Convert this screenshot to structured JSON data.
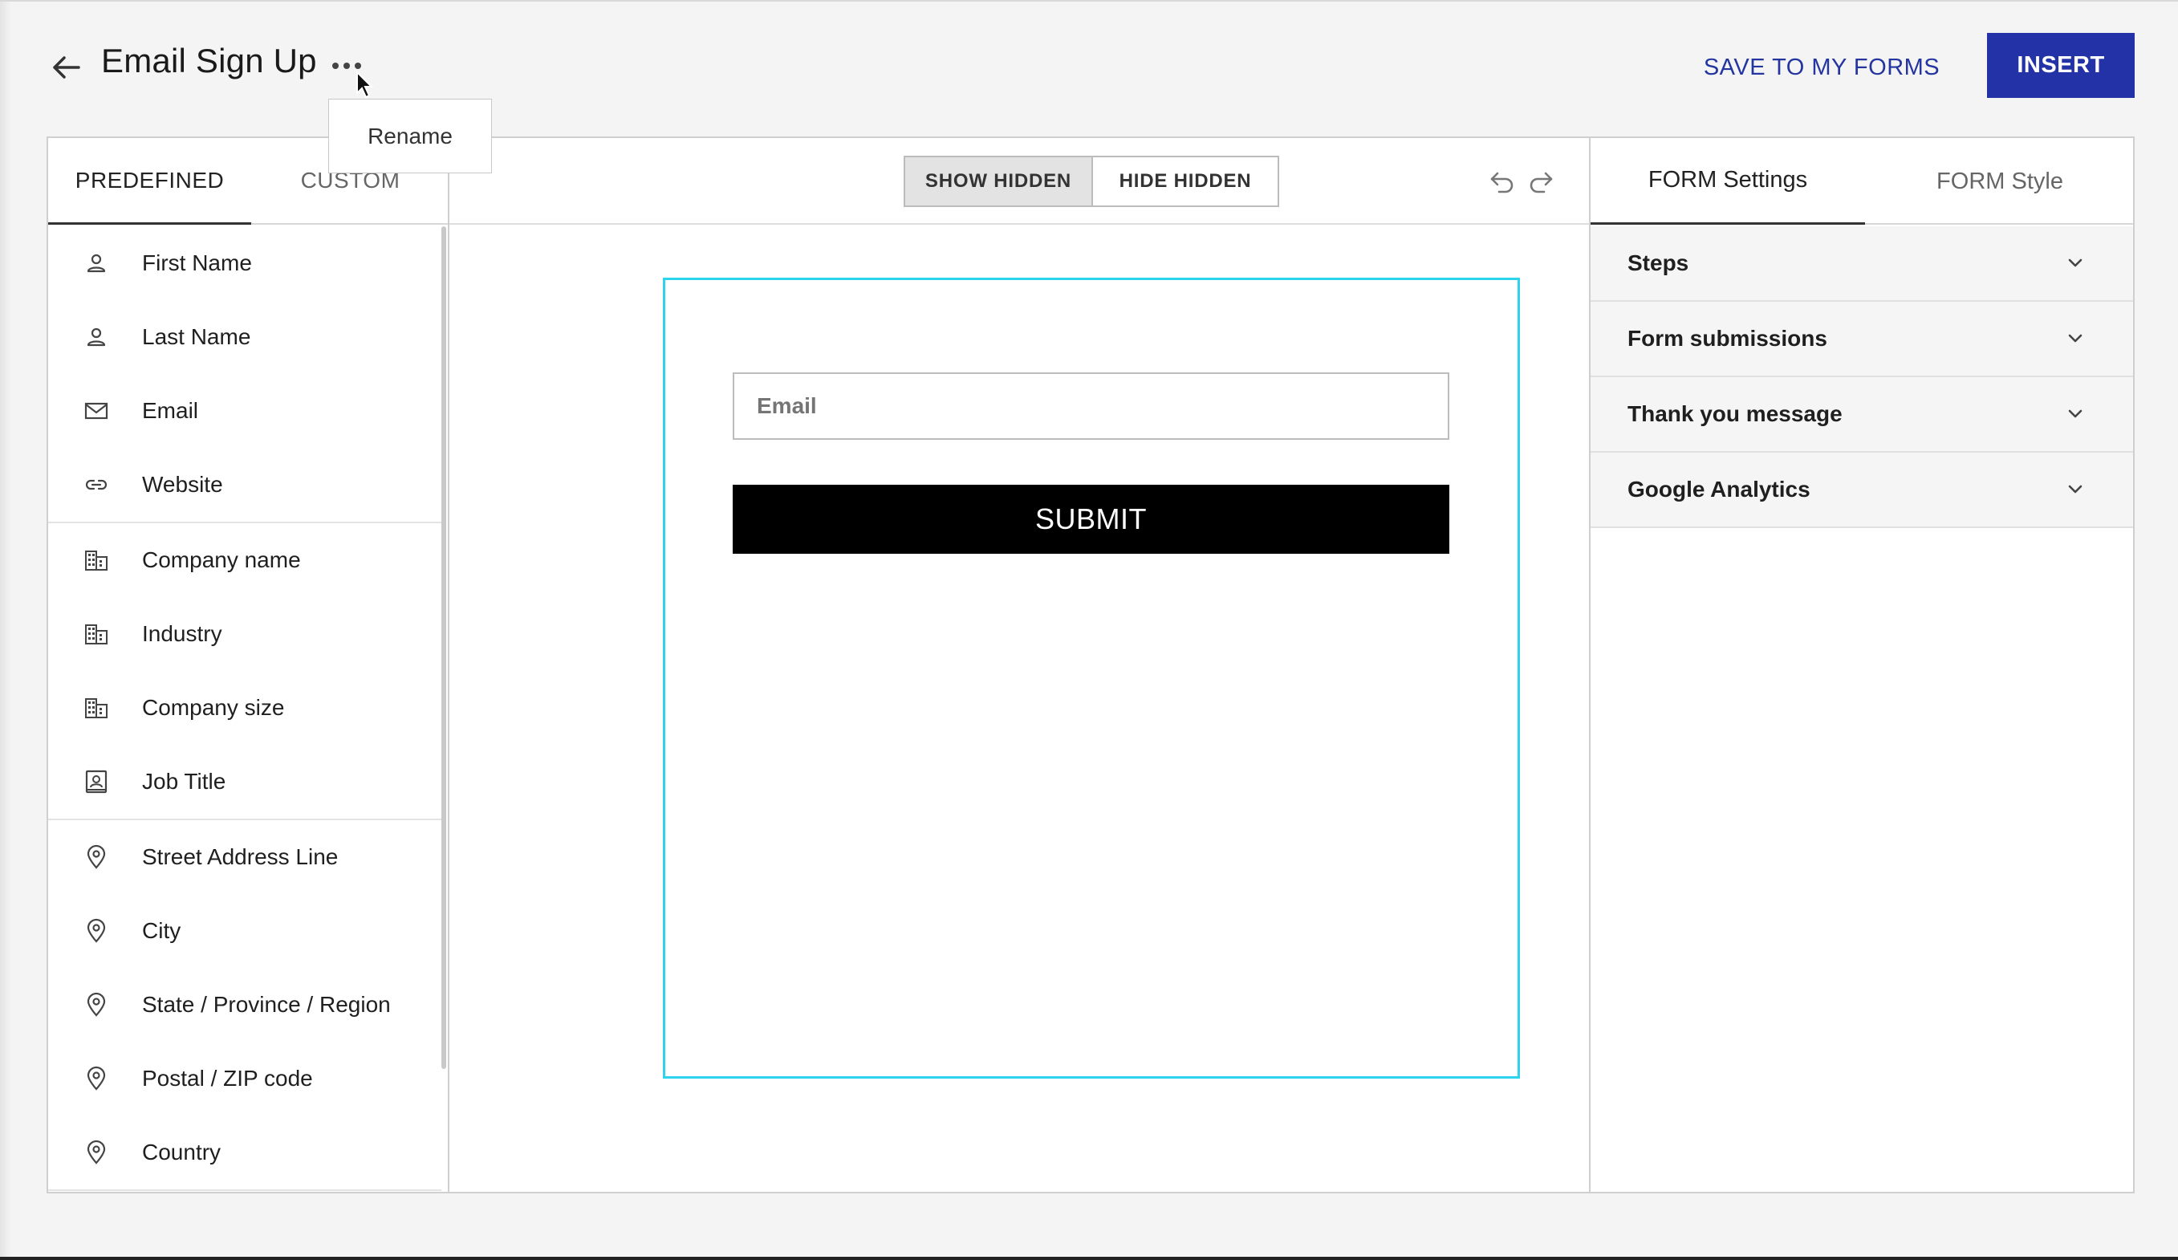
{
  "header": {
    "title": "Email Sign Up",
    "save_label": "SAVE TO MY FORMS",
    "insert_label": "INSERT",
    "rename_label": "Rename"
  },
  "left_panel": {
    "tabs": [
      {
        "label": "PREDEFINED",
        "active": true
      },
      {
        "label": "CUSTOM",
        "active": false
      }
    ],
    "fields": [
      {
        "label": "First Name",
        "icon": "person-icon"
      },
      {
        "label": "Last Name",
        "icon": "person-icon"
      },
      {
        "label": "Email",
        "icon": "envelope-icon"
      },
      {
        "label": "Website",
        "icon": "link-icon"
      },
      {
        "label": "Company name",
        "icon": "building-icon"
      },
      {
        "label": "Industry",
        "icon": "building-icon"
      },
      {
        "label": "Company size",
        "icon": "building-icon"
      },
      {
        "label": "Job Title",
        "icon": "id-badge-icon"
      },
      {
        "label": "Street Address Line",
        "icon": "location-pin-icon"
      },
      {
        "label": "City",
        "icon": "location-pin-icon"
      },
      {
        "label": "State / Province / Region",
        "icon": "location-pin-icon"
      },
      {
        "label": "Postal / ZIP code",
        "icon": "location-pin-icon"
      },
      {
        "label": "Country",
        "icon": "location-pin-icon"
      }
    ]
  },
  "center": {
    "toggle": {
      "show_label": "SHOW HIDDEN",
      "hide_label": "HIDE HIDDEN",
      "selected": "SHOW HIDDEN"
    },
    "form": {
      "email_placeholder": "Email",
      "submit_label": "SUBMIT",
      "border_color": "#2ed3ee"
    }
  },
  "right_panel": {
    "tabs": [
      {
        "label": "FORM Settings",
        "active": true
      },
      {
        "label": "FORM Style",
        "active": false
      }
    ],
    "sections": [
      {
        "label": "Steps"
      },
      {
        "label": "Form submissions"
      },
      {
        "label": "Thank you message"
      },
      {
        "label": "Google Analytics"
      }
    ]
  },
  "colors": {
    "accent": "#2432a8",
    "link": "#2435a0",
    "form_border": "#2ed3ee"
  }
}
